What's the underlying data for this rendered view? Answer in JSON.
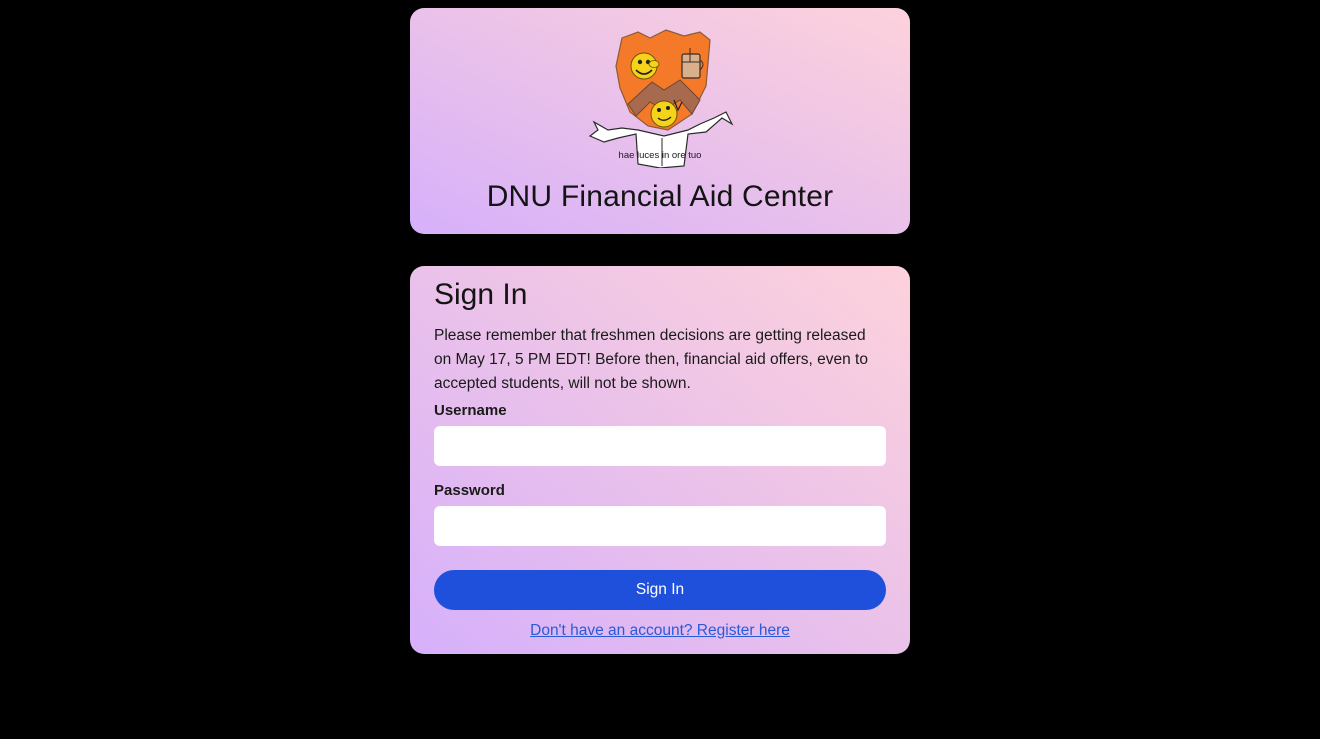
{
  "header": {
    "crest_motto": "hae luces in ore tuo",
    "title": "DNU Financial Aid Center"
  },
  "signin": {
    "heading": "Sign In",
    "notice": "Please remember that freshmen decisions are getting released on May 17, 5 PM EDT! Before then, financial aid offers, even to accepted students, will not be shown.",
    "username_label": "Username",
    "username_value": "",
    "password_label": "Password",
    "password_value": "",
    "submit_label": "Sign In",
    "register_link": "Don't have an account? Register here"
  },
  "colors": {
    "page_background": "#000000",
    "card_gradient_start": "#d6b0fb",
    "card_gradient_end": "#fdd2dc",
    "button": "#1f50dc",
    "link": "#2a5bd7",
    "crest_shield": "#f47a2a"
  },
  "icons": {
    "crest": "university-crest-logo"
  }
}
